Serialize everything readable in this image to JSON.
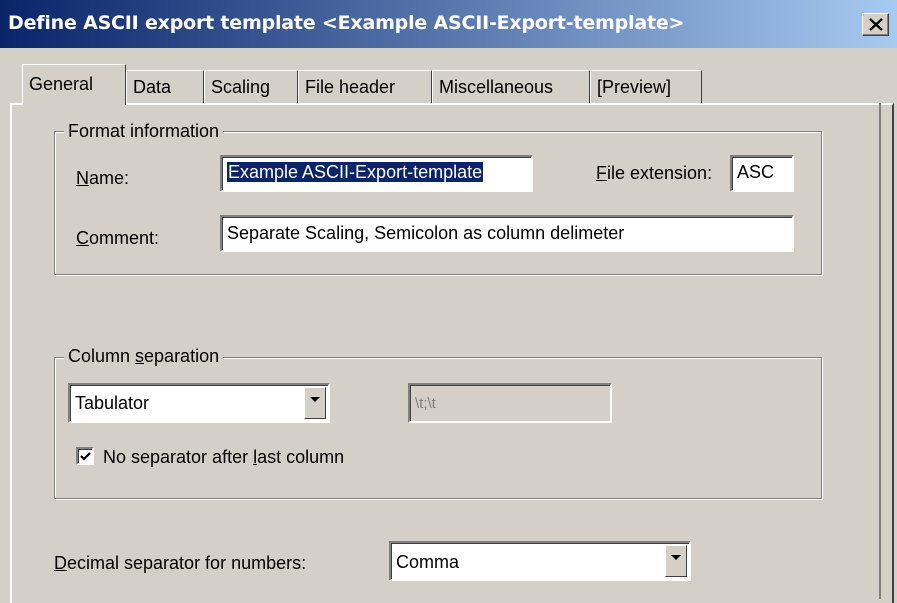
{
  "window": {
    "title": "Define ASCII export template <Example ASCII-Export-template>",
    "close_glyph": "✕"
  },
  "tabs": [
    {
      "label": "General",
      "active": true
    },
    {
      "label": "Data",
      "active": false
    },
    {
      "label": "Scaling",
      "active": false
    },
    {
      "label": "File header",
      "active": false
    },
    {
      "label": "Miscellaneous",
      "active": false
    },
    {
      "label": "[Preview]",
      "active": false
    }
  ],
  "format_info": {
    "group_title": "Format information",
    "name_label": "Name:",
    "name_value": "Example ASCII-Export-template",
    "file_ext_label": "File extension:",
    "file_ext_value": "ASC",
    "comment_label": "Comment:",
    "comment_value": "Separate Scaling, Semicolon as column delimeter"
  },
  "column_separation": {
    "group_title": "Column separation",
    "separator_value": "Tabulator",
    "custom_value": "\\t;\\t",
    "checkbox_label": "No separator after last column",
    "checkbox_checked": true
  },
  "decimal": {
    "label": "Decimal separator for numbers:",
    "value": "Comma"
  },
  "colors": {
    "title_start": "#0a246a",
    "title_end": "#a6caf0",
    "face": "#d4d0c8",
    "selection": "#0a246a"
  }
}
